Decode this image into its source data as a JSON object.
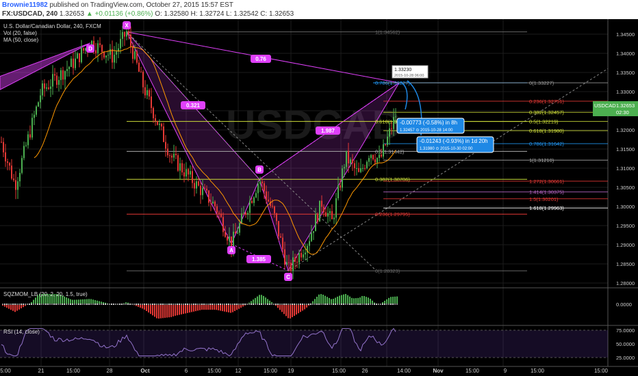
{
  "header": {
    "author": "Brownie11982",
    "published": "published on TradingView.com, October 27, 2015 15:57 EST",
    "symbol": "FX:USDCAD, 240",
    "last": "1.32653",
    "change_arrow": "▲",
    "change": "+0.01136 (+0.86%)",
    "ohlc": "O: 1.32580 H: 1.32724 L: 1.32542 C: 1.32653"
  },
  "legend": {
    "title": "U.S. Dollar/Canadian Dollar, 240, FXCM",
    "vol": "Vol (20, false)",
    "ma": "MA (50, close)"
  },
  "watermark": "USDCAD",
  "price_tag": {
    "symbol": "USDCAD",
    "value": "1.32653",
    "time": "02:30"
  },
  "xaxis": [
    "5:00",
    "21",
    "15:00",
    "28",
    "Oct",
    "6",
    "15:00",
    "12",
    "15:00",
    "19",
    "15:00",
    "26",
    "14:00",
    "Nov",
    "15:00",
    "9",
    "15:00",
    "15:00"
  ],
  "pane1_ticks": [
    "1.34500",
    "1.34000",
    "1.33500",
    "1.33000",
    "1.32500",
    "1.32000",
    "1.31500",
    "1.31000",
    "1.30500",
    "1.30000",
    "1.29500",
    "1.29000",
    "1.28500",
    "1.28000"
  ],
  "pane2": {
    "label": "SQZMOM_LB (20, 2, 20, 1.5, true)",
    "tick": "0.0000"
  },
  "pane3": {
    "label": "RSI (14, close)",
    "ticks": [
      "75.0000",
      "50.0000",
      "25.0000"
    ]
  },
  "pattern": {
    "points": [
      "X",
      "D",
      "B",
      "A",
      "C"
    ],
    "ratios": [
      "0.76",
      "0.321",
      "1.987",
      "1.385"
    ]
  },
  "fib_left": [
    "1(1.34562)",
    "0.786(1.33227)",
    "0.618(1.32219)",
    "0.5(1.31442)",
    "0.382(1.30706)",
    "0.236(1.29795)",
    "0(1.28323)"
  ],
  "fib_right": [
    "0(1.33227)",
    "0.236(1.32751)",
    "0.382(1.32457)",
    "0.5(1.32219)",
    "0.618(1.31980)",
    "0.786(1.31642)",
    "1(1.31210)",
    "1.272(1.30661)",
    "1.414(1.30375)",
    "1.5(1.30201)",
    "1.618(1.29963)"
  ],
  "projection_tooltip": {
    "value": "1.33230",
    "time": "2015-10-28 06:00"
  },
  "callouts": [
    {
      "title": "-0.00773 (-0.58%) in 8h",
      "sub": "1.32457  ⊙ 2015-10-28  14:00"
    },
    {
      "title": "-0.01243 (-0.93%) in 1d 20h",
      "sub": "1.31980  ⊙ 2015-10-30  02:00"
    }
  ],
  "chart_data": {
    "type": "candlestick",
    "title": "U.S. Dollar/Canadian Dollar, 240, FXCM",
    "ylim": [
      1.278,
      1.348
    ],
    "x_labels": [
      "21",
      "28",
      "Oct",
      "6",
      "12",
      "19",
      "26",
      "Nov",
      "9"
    ],
    "harmonic_points": [
      {
        "name": "X",
        "price": 1.3456
      },
      {
        "name": "A",
        "price": 1.2902
      },
      {
        "name": "B",
        "price": 1.3071
      },
      {
        "name": "C",
        "price": 1.2832
      },
      {
        "name": "D",
        "price": 1.3323
      }
    ],
    "rsi_ylim": [
      25,
      75
    ],
    "sqzmom_zero": 0.0
  },
  "colors": {
    "up": "#4caf50",
    "down": "#e53935",
    "pattern": "#e040fb",
    "fib_blue": "#2196f3",
    "fib_red": "#e53935",
    "fib_green": "#cddc39",
    "ma": "#ff9800",
    "callout": "#1e88e5"
  }
}
